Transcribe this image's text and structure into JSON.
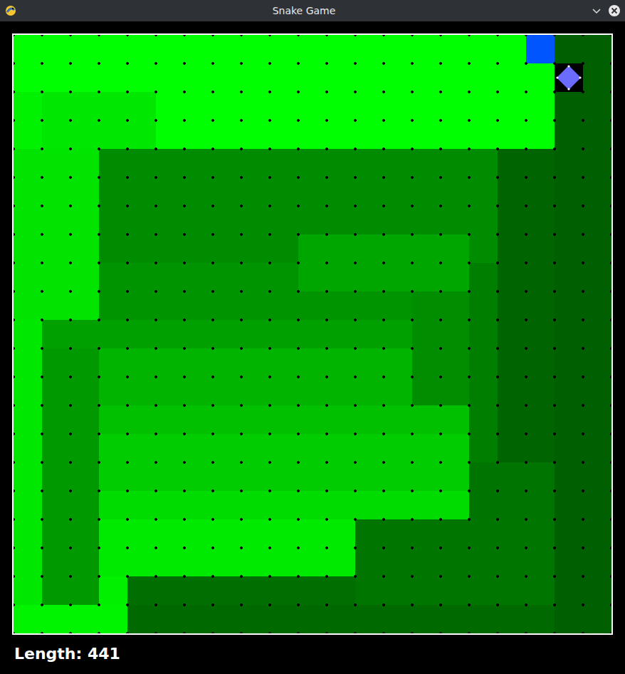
{
  "window": {
    "title": "Snake Game"
  },
  "score": "Length: 441",
  "board": {
    "cols": 21,
    "rows": 21,
    "head": [
      18,
      0
    ],
    "food": [
      19,
      1
    ],
    "regions": [
      {
        "c": 0,
        "r": 0,
        "w": 21,
        "h": 21,
        "color": "#007400"
      },
      {
        "c": 19,
        "r": 0,
        "w": 2,
        "h": 21,
        "color": "#005f00"
      },
      {
        "c": 17,
        "r": 4,
        "w": 2,
        "h": 11,
        "color": "#006500"
      },
      {
        "c": 0,
        "r": 0,
        "w": 18,
        "h": 2,
        "color": "#00ff00"
      },
      {
        "c": 18,
        "r": 1,
        "w": 1,
        "h": 3,
        "color": "#00ff00"
      },
      {
        "c": 0,
        "r": 2,
        "w": 1,
        "h": 2,
        "color": "#00f200"
      },
      {
        "c": 1,
        "r": 2,
        "w": 4,
        "h": 2,
        "color": "#00e800"
      },
      {
        "c": 5,
        "r": 2,
        "w": 13,
        "h": 2,
        "color": "#00ff00"
      },
      {
        "c": 0,
        "r": 4,
        "w": 3,
        "h": 6,
        "color": "#00e400"
      },
      {
        "c": 0,
        "r": 10,
        "w": 1,
        "h": 10,
        "color": "#00e800"
      },
      {
        "c": 3,
        "r": 4,
        "w": 14,
        "h": 4,
        "color": "#008c00"
      },
      {
        "c": 3,
        "r": 8,
        "w": 12,
        "h": 2,
        "color": "#009400"
      },
      {
        "c": 10,
        "r": 7,
        "w": 6,
        "h": 2,
        "color": "#00a600"
      },
      {
        "c": 14,
        "r": 9,
        "w": 2,
        "h": 4,
        "color": "#008e00"
      },
      {
        "c": 16,
        "r": 8,
        "w": 1,
        "h": 7,
        "color": "#007e00"
      },
      {
        "c": 1,
        "r": 10,
        "w": 13,
        "h": 1,
        "color": "#00a000"
      },
      {
        "c": 1,
        "r": 11,
        "w": 2,
        "h": 9,
        "color": "#009a00"
      },
      {
        "c": 3,
        "r": 11,
        "w": 11,
        "h": 2,
        "color": "#00b400"
      },
      {
        "c": 3,
        "r": 13,
        "w": 13,
        "h": 1,
        "color": "#00c000"
      },
      {
        "c": 3,
        "r": 14,
        "w": 13,
        "h": 2,
        "color": "#00cc00"
      },
      {
        "c": 3,
        "r": 16,
        "w": 13,
        "h": 1,
        "color": "#00dc00"
      },
      {
        "c": 3,
        "r": 17,
        "w": 9,
        "h": 2,
        "color": "#00ea00"
      },
      {
        "c": 12,
        "r": 17,
        "w": 7,
        "h": 3,
        "color": "#007600"
      },
      {
        "c": 3,
        "r": 19,
        "w": 1,
        "h": 1,
        "color": "#00f000"
      },
      {
        "c": 4,
        "r": 19,
        "w": 8,
        "h": 1,
        "color": "#006e00"
      },
      {
        "c": 0,
        "r": 20,
        "w": 4,
        "h": 1,
        "color": "#00f400"
      },
      {
        "c": 4,
        "r": 20,
        "w": 15,
        "h": 1,
        "color": "#006a00"
      }
    ]
  }
}
